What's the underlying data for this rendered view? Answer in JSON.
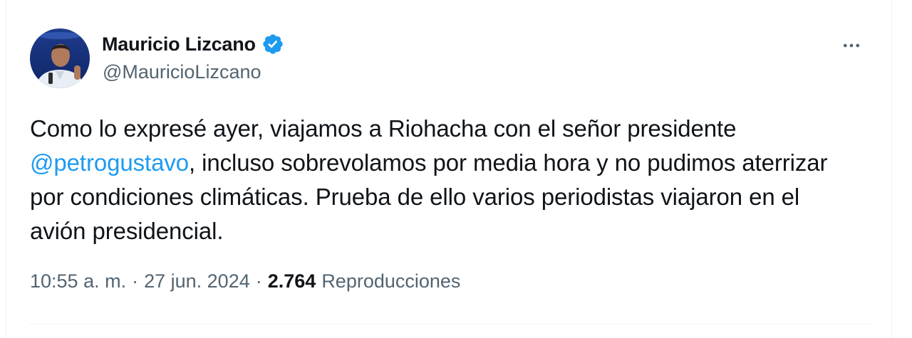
{
  "author": {
    "display_name": "Mauricio Lizcano",
    "handle": "@MauricioLizcano",
    "verified": true,
    "avatar_icon": "profile-photo",
    "verified_icon": "verified-badge-icon",
    "verified_color": "#1d9bf0"
  },
  "tweet": {
    "text_part1": "Como lo expresé ayer, viajamos a Riohacha con el señor presidente ",
    "mention": "@petrogustavo",
    "text_part2": ", incluso sobrevolamos por media hora y no pudimos aterrizar por condiciones climáticas. Prueba de ello varios periodistas viajaron en el avión presidencial.",
    "mention_color": "#1d9bf0"
  },
  "meta": {
    "time": "10:55 a. m.",
    "separator": "·",
    "date": "27 jun. 2024",
    "views_count": "2.764",
    "views_label": "Reproducciones"
  },
  "menu": {
    "more_icon": "more-horizontal-icon"
  }
}
